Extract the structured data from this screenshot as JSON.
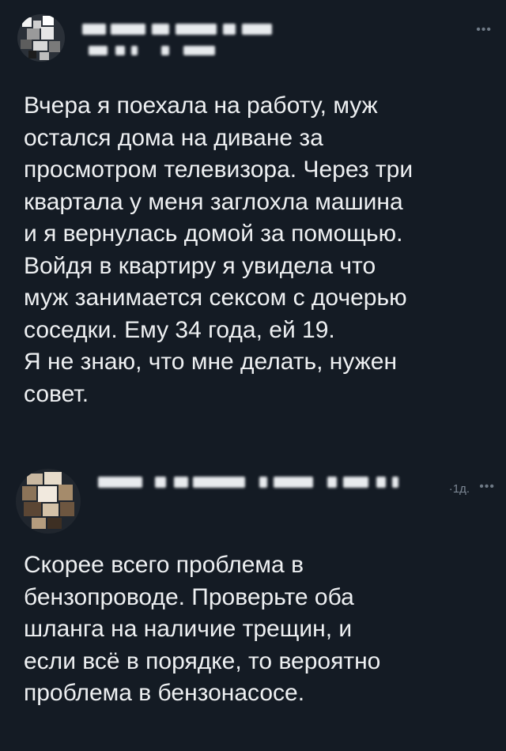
{
  "posts": [
    {
      "menu_icon": "more-horizontal-icon",
      "lines": [
        "Вчера я поехала на работу, муж",
        "остался дома на диване за",
        "просмотром телевизора. Через три",
        "квартала у меня заглохла машина",
        "и я вернулась домой за помощью.",
        "Войдя в квартиру я увидела что",
        "муж занимается сексом с дочерью",
        "соседки. Ему 34 года, ей 19.",
        "Я не знаю, что мне делать, нужен",
        "совет."
      ]
    },
    {
      "timestamp": "·1д.",
      "menu_icon": "more-horizontal-icon",
      "lines": [
        "Скорее всего проблема в",
        "бензопроводе. Проверьте оба",
        "шланга на наличие трещин, и",
        "если всё в порядке, то вероятно",
        "проблема в бензонасосе."
      ]
    }
  ],
  "colors": {
    "background": "#141b24",
    "text": "#eef0f2",
    "muted": "#7c8794"
  }
}
